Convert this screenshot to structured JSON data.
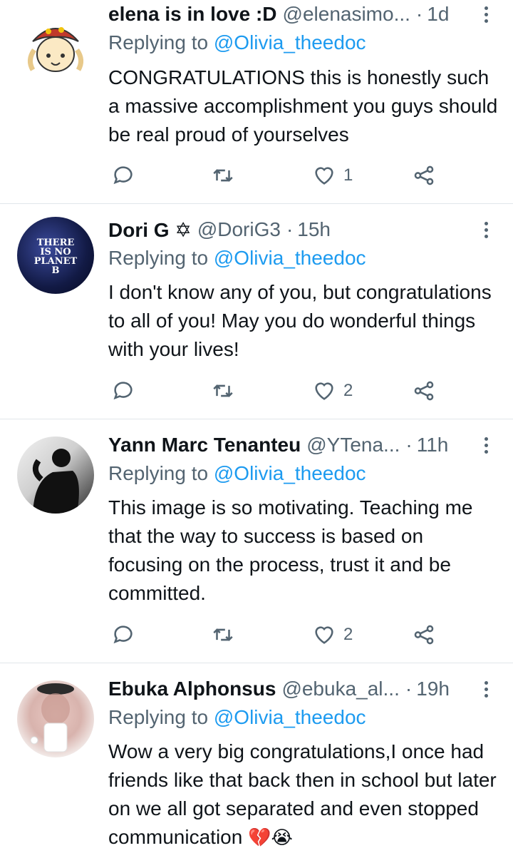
{
  "tweets": [
    {
      "name": "elena is in love :D",
      "handle": "@elenasimo...",
      "sep": "·",
      "time": "1d",
      "replying_prefix": "Replying to",
      "replying_to": "@Olivia_theedoc",
      "text": "CONGRATULATIONS this is honestly such a massive accomplishment you guys should be real proud of yourselves",
      "likes": "1",
      "avatar_icon": "anime-avatar"
    },
    {
      "name": "Dori G ✡",
      "handle": "@DoriG3",
      "sep": "·",
      "time": "15h",
      "replying_prefix": "Replying to",
      "replying_to": "@Olivia_theedoc",
      "text": "I don't know any of you, but congratulations to all of you! May you do wonderful things with your lives!",
      "likes": "2",
      "avatar_text": [
        "THERE",
        "IS NO",
        "PLANET",
        "B"
      ]
    },
    {
      "name": "Yann Marc Tenanteu",
      "handle": "@YTena...",
      "sep": "·",
      "time": "11h",
      "replying_prefix": "Replying to",
      "replying_to": "@Olivia_theedoc",
      "text": "This image is so motivating. Teaching me that the way to success is based on focusing on the process, trust it and be committed.",
      "likes": "2",
      "avatar_icon": "silhouette-avatar"
    },
    {
      "name": "Ebuka Alphonsus",
      "handle": "@ebuka_al...",
      "sep": "·",
      "time": "19h",
      "replying_prefix": "Replying to",
      "replying_to": "@Olivia_theedoc",
      "text": "Wow a very big congratulations,I once had friends like that back then in school but later on we all got separated and even stopped communication",
      "text_emojis": "💔😭",
      "avatar_icon": "photo-avatar"
    }
  ],
  "colors": {
    "link": "#1d9bf0",
    "secondary": "#536471",
    "text": "#0f1419",
    "divider": "#e1e6ea"
  }
}
